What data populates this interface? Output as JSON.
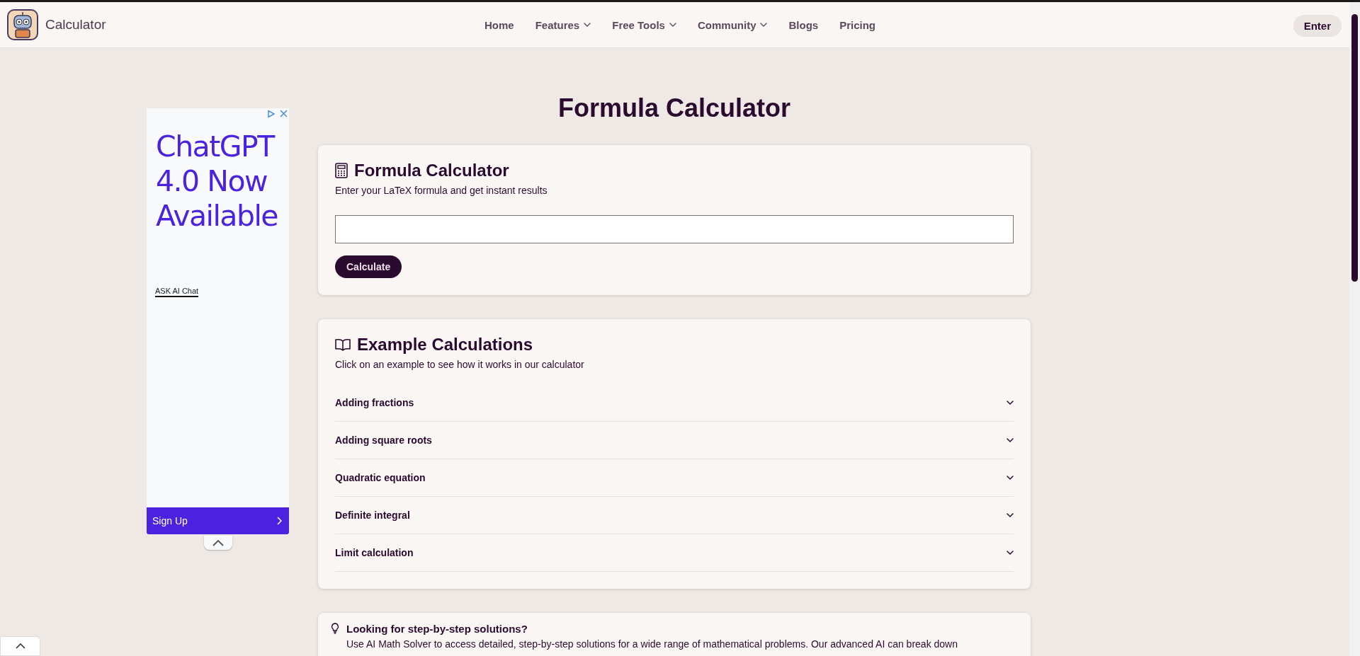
{
  "header": {
    "brand": "Calculator",
    "nav": [
      {
        "label": "Home",
        "kind": "link"
      },
      {
        "label": "Features",
        "kind": "dropdown"
      },
      {
        "label": "Free Tools",
        "kind": "dropdown"
      },
      {
        "label": "Community",
        "kind": "dropdown"
      },
      {
        "label": "Blogs",
        "kind": "link"
      },
      {
        "label": "Pricing",
        "kind": "link"
      }
    ],
    "enter_button": "Enter"
  },
  "ad": {
    "headline": "ChatGPT 4.0 Now Available",
    "link": "ASK AI Chat",
    "cta": "Sign Up"
  },
  "page_title": "Formula Calculator",
  "calculator": {
    "title": "Formula Calculator",
    "subtitle": "Enter your LaTeX formula and get instant results",
    "button": "Calculate"
  },
  "examples": {
    "title": "Example Calculations",
    "subtitle": "Click on an example to see how it works in our calculator",
    "items": [
      {
        "label": "Adding fractions",
        "expanded": false
      },
      {
        "label": "Adding square roots",
        "expanded": false
      },
      {
        "label": "Quadratic equation",
        "expanded": false
      },
      {
        "label": "Definite integral",
        "expanded": false
      },
      {
        "label": "Limit calculation",
        "expanded": false
      }
    ]
  },
  "tip": {
    "title": "Looking for step-by-step solutions?",
    "text": "Use AI Math Solver to access detailed, step-by-step solutions for a wide range of mathematical problems. Our advanced AI can break down"
  }
}
